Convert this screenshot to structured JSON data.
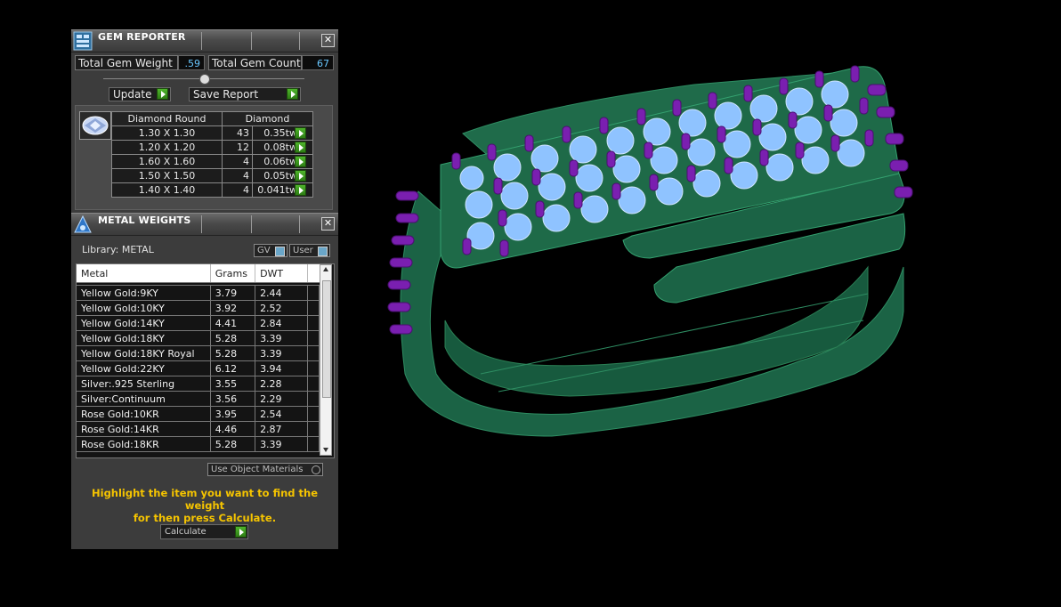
{
  "gem_reporter": {
    "title": "GEM REPORTER",
    "total_weight_label": "Total Gem Weight",
    "total_weight_value": ".59",
    "total_count_label": "Total Gem Count",
    "total_count_value": "67",
    "update_label": "Update",
    "save_report_label": "Save Report",
    "col_shape": "Diamond Round",
    "col_material": "Diamond",
    "rows": [
      {
        "size": "1.30 X 1.30",
        "count": "43",
        "weight": "0.35tw"
      },
      {
        "size": "1.20 X 1.20",
        "count": "12",
        "weight": "0.08tw"
      },
      {
        "size": "1.60 X 1.60",
        "count": "4",
        "weight": "0.06tw"
      },
      {
        "size": "1.50 X 1.50",
        "count": "4",
        "weight": "0.05tw"
      },
      {
        "size": "1.40 X 1.40",
        "count": "4",
        "weight": "0.041tw"
      }
    ]
  },
  "metal_weights": {
    "title": "METAL WEIGHTS",
    "library_label": "Library: METAL",
    "gv_label": "GV",
    "user_label": "User",
    "headers": [
      "Metal",
      "Grams",
      "DWT"
    ],
    "rows": [
      {
        "metal": "Yellow Gold:9KY",
        "grams": "3.79",
        "dwt": "2.44"
      },
      {
        "metal": "Yellow Gold:10KY",
        "grams": "3.92",
        "dwt": "2.52"
      },
      {
        "metal": "Yellow Gold:14KY",
        "grams": "4.41",
        "dwt": "2.84"
      },
      {
        "metal": "Yellow Gold:18KY",
        "grams": "5.28",
        "dwt": "3.39"
      },
      {
        "metal": "Yellow Gold:18KY Royal",
        "grams": "5.28",
        "dwt": "3.39"
      },
      {
        "metal": "Yellow Gold:22KY",
        "grams": "6.12",
        "dwt": "3.94"
      },
      {
        "metal": "Silver:.925 Sterling",
        "grams": "3.55",
        "dwt": "2.28"
      },
      {
        "metal": "Silver:Continuum",
        "grams": "3.56",
        "dwt": "2.29"
      },
      {
        "metal": "Rose Gold:10KR",
        "grams": "3.95",
        "dwt": "2.54"
      },
      {
        "metal": "Rose Gold:14KR",
        "grams": "4.46",
        "dwt": "2.87"
      },
      {
        "metal": "Rose Gold:18KR",
        "grams": "5.28",
        "dwt": "3.39"
      }
    ],
    "use_object_materials_label": "Use Object Materials",
    "hint_line1": "Highlight the item you want to find the weight",
    "hint_line2": "for then press Calculate.",
    "calculate_label": "Calculate"
  },
  "colors": {
    "ring_metal": "#1f6b4a",
    "gem_blue": "#8fc3ff",
    "prong_purple": "#7a1fb0",
    "hint_yellow": "#f5c400",
    "value_blue": "#69c7ff"
  },
  "icons": [
    "gem-reporter-icon",
    "close-icon",
    "diamond-round-icon",
    "metal-weights-icon",
    "go-arrow-icon"
  ]
}
